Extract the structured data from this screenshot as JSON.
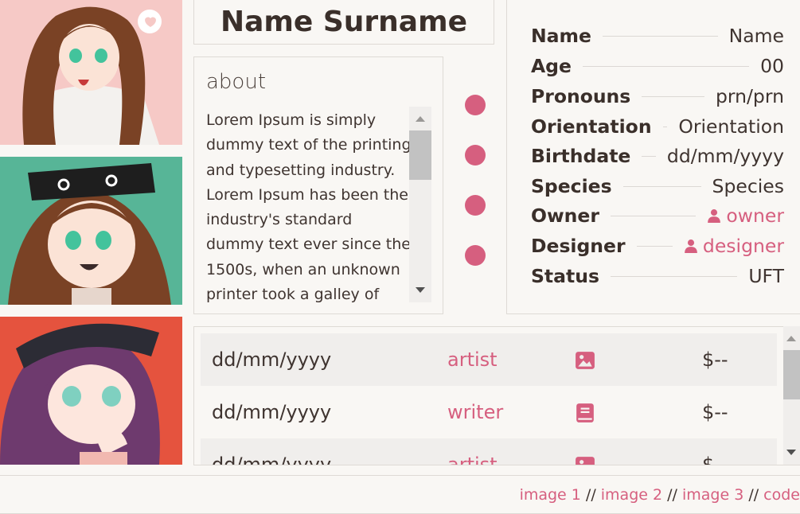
{
  "profile": {
    "name": "Name Surname"
  },
  "about": {
    "title": "about",
    "text": "Lorem Ipsum is simply dummy text of the printing and typesetting industry. Lorem Ipsum has been the industry's standard dummy text ever since the 1500s, when an unknown printer took a galley of type and"
  },
  "stats": [
    {
      "label": "Name",
      "value": "Name"
    },
    {
      "label": "Age",
      "value": "00"
    },
    {
      "label": "Pronouns",
      "value": "prn/prn"
    },
    {
      "label": "Orientation",
      "value": "Orientation"
    },
    {
      "label": "Birthdate",
      "value": "dd/mm/yyyy"
    },
    {
      "label": "Species",
      "value": "Species"
    },
    {
      "label": "Owner",
      "value": "owner",
      "icon": "user-icon"
    },
    {
      "label": "Designer",
      "value": "designer",
      "icon": "user-icon"
    },
    {
      "label": "Status",
      "value": "UFT"
    }
  ],
  "history": [
    {
      "date": "dd/mm/yyyy",
      "role": "artist",
      "icon": "image-icon",
      "price": "$--"
    },
    {
      "date": "dd/mm/yyyy",
      "role": "writer",
      "icon": "book-icon",
      "price": "$--"
    },
    {
      "date": "dd/mm/yyyy",
      "role": "artist",
      "icon": "image-icon",
      "price": "$--"
    }
  ],
  "footer": {
    "link1": "image 1",
    "link2": "image 2",
    "link3": "image 3",
    "link4": "code",
    "separator": " // "
  },
  "colors": {
    "accent": "#d65f7f",
    "background": "#f9f7f4",
    "text": "#3a2f2a",
    "portrait1_bg": "#f6c9c6",
    "portrait2_bg": "#57b597",
    "portrait3_bg": "#e5533e"
  }
}
